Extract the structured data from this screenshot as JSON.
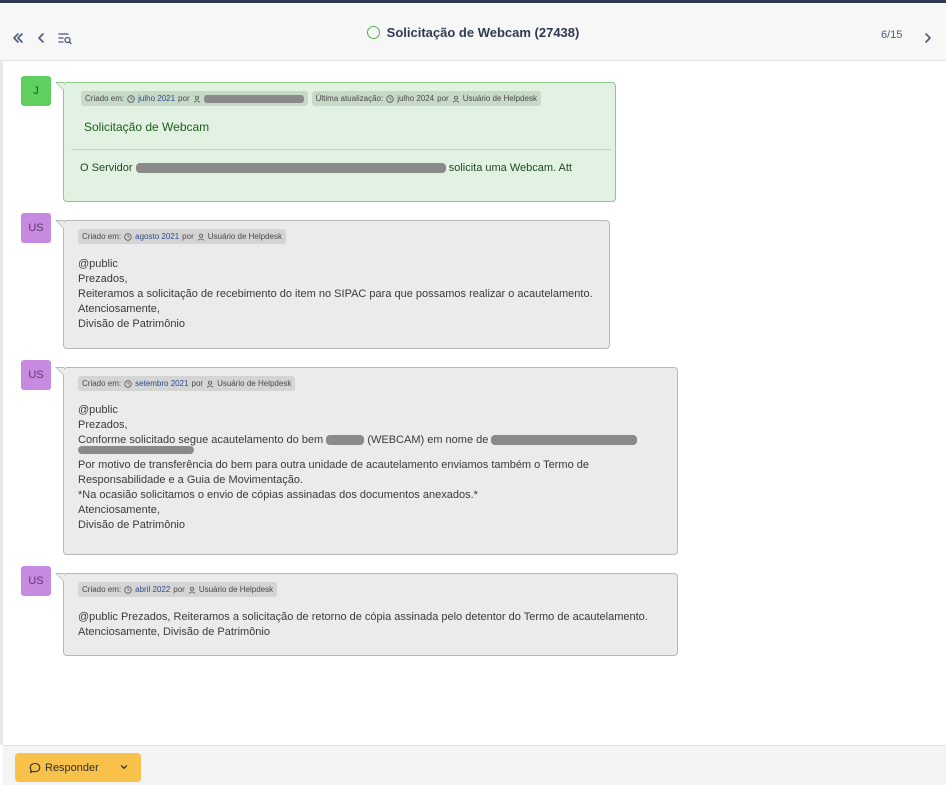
{
  "header": {
    "title": "Solicitação de Webcam (27438)",
    "counter": "6/15",
    "status_color": "#4bb34b"
  },
  "icons": {
    "first": "double-chevron-left-icon",
    "prev": "chevron-left-icon",
    "filter": "list-search-icon",
    "next": "chevron-right-icon",
    "clock": "clock-icon",
    "user": "user-icon",
    "comment": "comment-icon"
  },
  "messages": [
    {
      "avatar": "J",
      "avatar_color": "#5fcf5f",
      "meta": {
        "created_label": "Criado em:",
        "created_date": "julho 2021",
        "by": "por",
        "updated_label": "Última atualização:",
        "updated_date": "julho 2024",
        "updated_by": "por",
        "updated_user": "Usuário de Helpdesk"
      },
      "title": "Solicitação de Webcam",
      "body_prefix": "O Servidor",
      "body_suffix": "solicita uma Webcam. Att"
    },
    {
      "avatar": "US",
      "avatar_color": "#c889e0",
      "meta": {
        "created_label": "Criado em:",
        "created_date": "agosto 2021",
        "by": "por",
        "user": "Usuário de Helpdesk"
      },
      "lines": [
        "@public",
        "Prezados,",
        "Reiteramos a solicitação de recebimento do item no SIPAC para que possamos realizar o acautelamento.",
        "Atenciosamente,",
        "Divisão de Patrimônio"
      ]
    },
    {
      "avatar": "US",
      "avatar_color": "#c889e0",
      "meta": {
        "created_label": "Criado em:",
        "created_date": "setembro 2021",
        "by": "por",
        "user": "Usuário de Helpdesk"
      },
      "line1": "@public",
      "line2": "Prezados,",
      "line3_a": "Conforme solicitado segue acautelamento do bem",
      "line3_b": "(WEBCAM) em nome de",
      "line4": "Por motivo de transferência do bem para outra unidade de acautelamento enviamos também o Termo de",
      "line5": "Responsabilidade e a Guia de Movimentação.",
      "line6": "*Na ocasião solicitamos o envio de cópias assinadas dos documentos anexados.*",
      "line7": "Atenciosamente,",
      "line8": "Divisão de Patrimônio"
    },
    {
      "avatar": "US",
      "avatar_color": "#c889e0",
      "meta": {
        "created_label": "Criado em:",
        "created_date": "abril 2022",
        "by": "por",
        "user": "Usuário de Helpdesk"
      },
      "line1": "@public Prezados, Reiteramos a solicitação de retorno de cópia assinada pelo detentor do Termo de acautelamento.",
      "line2": "Atenciosamente, Divisão de Patrimônio"
    }
  ],
  "footer": {
    "reply_label": "Responder",
    "reply_color": "#f7c14a"
  }
}
